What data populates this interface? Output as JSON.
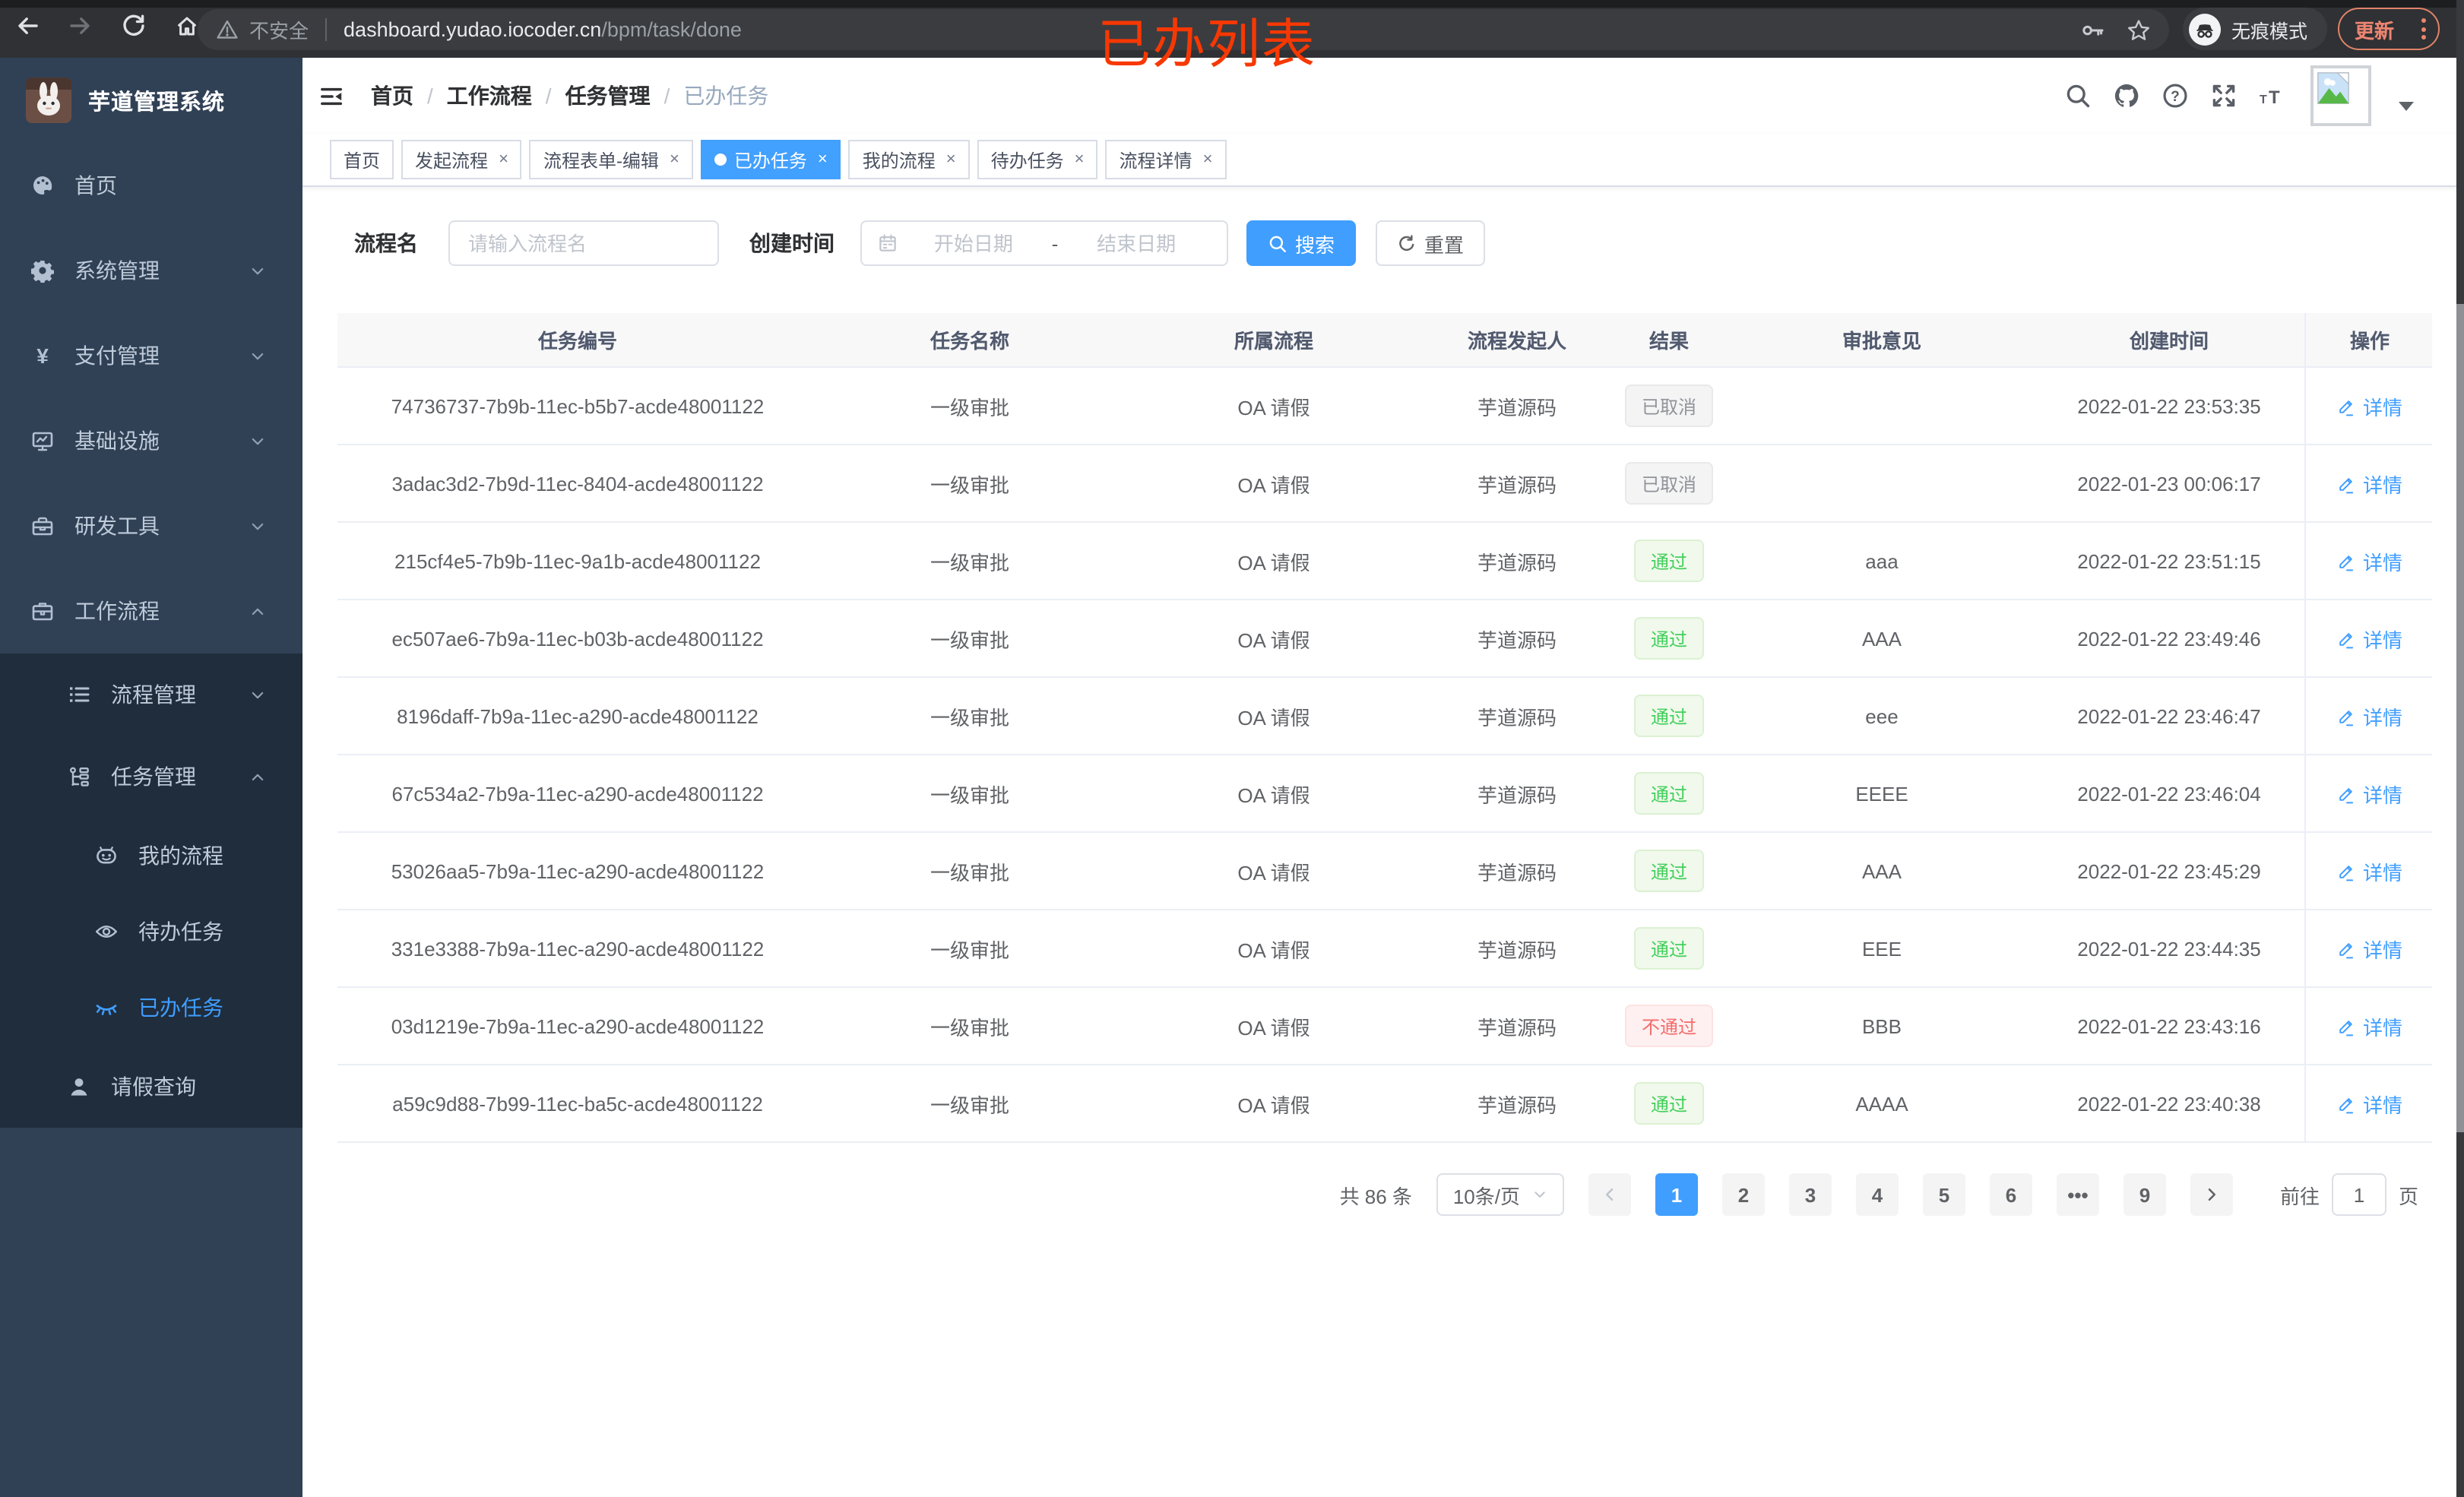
{
  "browser": {
    "insecure": "不安全",
    "url_host": "dashboard.yudao.iocoder.cn",
    "url_path": "/bpm/task/done",
    "incognito": "无痕模式",
    "update": "更新",
    "annotation": "已办列表"
  },
  "sidebar": {
    "logo_title": "芋道管理系统",
    "items": [
      {
        "key": "home",
        "label": "首页",
        "icon": "dashboard",
        "level": 0
      },
      {
        "key": "system",
        "label": "系统管理",
        "icon": "gear",
        "level": 0,
        "chevron": "down"
      },
      {
        "key": "payment",
        "label": "支付管理",
        "icon": "yen",
        "level": 0,
        "chevron": "down"
      },
      {
        "key": "infra",
        "label": "基础设施",
        "icon": "monitor",
        "level": 0,
        "chevron": "down"
      },
      {
        "key": "devtools",
        "label": "研发工具",
        "icon": "toolbox",
        "level": 0,
        "chevron": "down"
      },
      {
        "key": "workflow",
        "label": "工作流程",
        "icon": "briefcase",
        "level": 0,
        "chevron": "up"
      },
      {
        "key": "process-mgmt",
        "label": "流程管理",
        "icon": "list",
        "level": 1,
        "chevron": "down"
      },
      {
        "key": "task-mgmt",
        "label": "任务管理",
        "icon": "tree",
        "level": 1,
        "chevron": "up"
      },
      {
        "key": "my-process",
        "label": "我的流程",
        "icon": "robot",
        "level": 2
      },
      {
        "key": "todo-tasks",
        "label": "待办任务",
        "icon": "eye",
        "level": 2
      },
      {
        "key": "done-tasks",
        "label": "已办任务",
        "icon": "eye-closed",
        "level": 2,
        "active": true
      },
      {
        "key": "leave-query",
        "label": "请假查询",
        "icon": "user",
        "level": 1
      }
    ]
  },
  "header": {
    "breadcrumb": [
      "首页",
      "工作流程",
      "任务管理",
      "已办任务"
    ]
  },
  "tabs": [
    {
      "key": "home",
      "label": "首页",
      "closable": false
    },
    {
      "key": "start-process",
      "label": "发起流程",
      "closable": true
    },
    {
      "key": "form-edit",
      "label": "流程表单-编辑",
      "closable": true
    },
    {
      "key": "done-tasks",
      "label": "已办任务",
      "closable": true,
      "active": true
    },
    {
      "key": "my-process",
      "label": "我的流程",
      "closable": true
    },
    {
      "key": "todo-tasks",
      "label": "待办任务",
      "closable": true
    },
    {
      "key": "process-detail",
      "label": "流程详情",
      "closable": true
    }
  ],
  "filters": {
    "name_label": "流程名",
    "name_placeholder": "请输入流程名",
    "time_label": "创建时间",
    "start_placeholder": "开始日期",
    "separator": "-",
    "end_placeholder": "结束日期",
    "search": "搜索",
    "reset": "重置"
  },
  "table": {
    "columns": [
      "任务编号",
      "任务名称",
      "所属流程",
      "流程发起人",
      "结果",
      "审批意见",
      "创建时间",
      "操作"
    ],
    "detail_label": "详情",
    "rows": [
      {
        "id": "74736737-7b9b-11ec-b5b7-acde48001122",
        "name": "一级审批",
        "process": "OA 请假",
        "starter": "芋道源码",
        "result": "已取消",
        "result_type": "info",
        "opinion": "",
        "time": "2022-01-22 23:53:35"
      },
      {
        "id": "3adac3d2-7b9d-11ec-8404-acde48001122",
        "name": "一级审批",
        "process": "OA 请假",
        "starter": "芋道源码",
        "result": "已取消",
        "result_type": "info",
        "opinion": "",
        "time": "2022-01-23 00:06:17"
      },
      {
        "id": "215cf4e5-7b9b-11ec-9a1b-acde48001122",
        "name": "一级审批",
        "process": "OA 请假",
        "starter": "芋道源码",
        "result": "通过",
        "result_type": "success",
        "opinion": "aaa",
        "time": "2022-01-22 23:51:15"
      },
      {
        "id": "ec507ae6-7b9a-11ec-b03b-acde48001122",
        "name": "一级审批",
        "process": "OA 请假",
        "starter": "芋道源码",
        "result": "通过",
        "result_type": "success",
        "opinion": "AAA",
        "time": "2022-01-22 23:49:46"
      },
      {
        "id": "8196daff-7b9a-11ec-a290-acde48001122",
        "name": "一级审批",
        "process": "OA 请假",
        "starter": "芋道源码",
        "result": "通过",
        "result_type": "success",
        "opinion": "eee",
        "time": "2022-01-22 23:46:47"
      },
      {
        "id": "67c534a2-7b9a-11ec-a290-acde48001122",
        "name": "一级审批",
        "process": "OA 请假",
        "starter": "芋道源码",
        "result": "通过",
        "result_type": "success",
        "opinion": "EEEE",
        "time": "2022-01-22 23:46:04"
      },
      {
        "id": "53026aa5-7b9a-11ec-a290-acde48001122",
        "name": "一级审批",
        "process": "OA 请假",
        "starter": "芋道源码",
        "result": "通过",
        "result_type": "success",
        "opinion": "AAA",
        "time": "2022-01-22 23:45:29"
      },
      {
        "id": "331e3388-7b9a-11ec-a290-acde48001122",
        "name": "一级审批",
        "process": "OA 请假",
        "starter": "芋道源码",
        "result": "通过",
        "result_type": "success",
        "opinion": "EEE",
        "time": "2022-01-22 23:44:35"
      },
      {
        "id": "03d1219e-7b9a-11ec-a290-acde48001122",
        "name": "一级审批",
        "process": "OA 请假",
        "starter": "芋道源码",
        "result": "不通过",
        "result_type": "danger",
        "opinion": "BBB",
        "time": "2022-01-22 23:43:16"
      },
      {
        "id": "a59c9d88-7b99-11ec-ba5c-acde48001122",
        "name": "一级审批",
        "process": "OA 请假",
        "starter": "芋道源码",
        "result": "通过",
        "result_type": "success",
        "opinion": "AAAA",
        "time": "2022-01-22 23:40:38"
      }
    ]
  },
  "pagination": {
    "total": "共 86 条",
    "page_size": "10条/页",
    "pages": [
      "1",
      "2",
      "3",
      "4",
      "5",
      "6",
      "•••",
      "9"
    ],
    "active_page": "1",
    "goto": "前往",
    "goto_value": "1",
    "page_unit": "页"
  },
  "colors": {
    "accent": "#409eff",
    "success": "#43cf5c",
    "danger": "#f56c6c",
    "info": "#909399",
    "sidebar_bg": "#304156",
    "submenu_bg": "#1f2d3d",
    "annotation_red": "#f73802",
    "active_tab_bg": "#42a0ff"
  }
}
